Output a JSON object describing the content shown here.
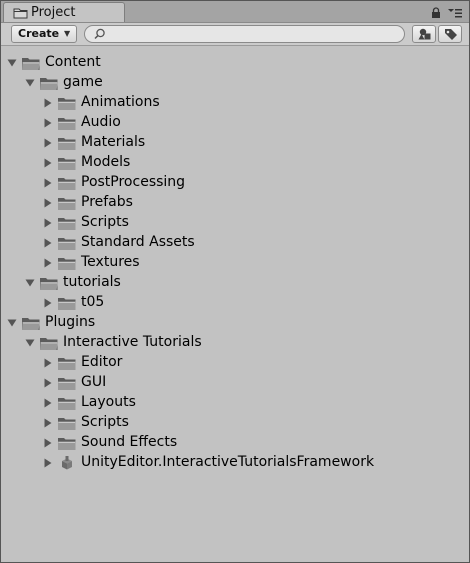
{
  "panel": {
    "tab_title": "Project"
  },
  "toolbar": {
    "create_label": "Create",
    "search_value": ""
  },
  "tree": [
    {
      "label": "Content",
      "depth": 0,
      "expanded": true,
      "kind": "folder"
    },
    {
      "label": "game",
      "depth": 1,
      "expanded": true,
      "kind": "folder"
    },
    {
      "label": "Animations",
      "depth": 2,
      "expanded": false,
      "kind": "folder"
    },
    {
      "label": "Audio",
      "depth": 2,
      "expanded": false,
      "kind": "folder"
    },
    {
      "label": "Materials",
      "depth": 2,
      "expanded": false,
      "kind": "folder"
    },
    {
      "label": "Models",
      "depth": 2,
      "expanded": false,
      "kind": "folder"
    },
    {
      "label": "PostProcessing",
      "depth": 2,
      "expanded": false,
      "kind": "folder"
    },
    {
      "label": "Prefabs",
      "depth": 2,
      "expanded": false,
      "kind": "folder"
    },
    {
      "label": "Scripts",
      "depth": 2,
      "expanded": false,
      "kind": "folder"
    },
    {
      "label": "Standard Assets",
      "depth": 2,
      "expanded": false,
      "kind": "folder"
    },
    {
      "label": "Textures",
      "depth": 2,
      "expanded": false,
      "kind": "folder"
    },
    {
      "label": "tutorials",
      "depth": 1,
      "expanded": true,
      "kind": "folder"
    },
    {
      "label": "t05",
      "depth": 2,
      "expanded": false,
      "kind": "folder"
    },
    {
      "label": "Plugins",
      "depth": 0,
      "expanded": true,
      "kind": "folder"
    },
    {
      "label": "Interactive Tutorials",
      "depth": 1,
      "expanded": true,
      "kind": "folder"
    },
    {
      "label": "Editor",
      "depth": 2,
      "expanded": false,
      "kind": "folder"
    },
    {
      "label": "GUI",
      "depth": 2,
      "expanded": false,
      "kind": "folder"
    },
    {
      "label": "Layouts",
      "depth": 2,
      "expanded": false,
      "kind": "folder"
    },
    {
      "label": "Scripts",
      "depth": 2,
      "expanded": false,
      "kind": "folder"
    },
    {
      "label": "Sound Effects",
      "depth": 2,
      "expanded": false,
      "kind": "folder"
    },
    {
      "label": "UnityEditor.InteractiveTutorialsFramework",
      "depth": 2,
      "expanded": false,
      "kind": "package"
    }
  ]
}
